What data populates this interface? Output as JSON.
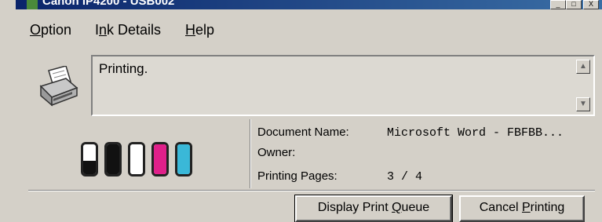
{
  "window": {
    "title": "Canon iP4200 - USB002",
    "minimize_glyph": "_",
    "maximize_glyph": "□",
    "close_glyph": "X"
  },
  "menu": {
    "option": {
      "prefix": "",
      "accel": "O",
      "rest": "ption"
    },
    "ink_details": {
      "prefix": "I",
      "accel": "n",
      "rest": "k Details"
    },
    "help": {
      "prefix": "",
      "accel": "H",
      "rest": "elp"
    }
  },
  "status": {
    "message": "Printing.",
    "scroll_up_glyph": "▲",
    "scroll_down_glyph": "▼"
  },
  "ink_tanks": [
    {
      "color": "#111111",
      "level": 0.45
    },
    {
      "color": "#111111",
      "level": 1.0
    },
    {
      "color": "#ffffff",
      "level": 1.0
    },
    {
      "color": "#e0208a",
      "level": 1.0
    },
    {
      "color": "#3ab8d8",
      "level": 1.0
    }
  ],
  "document": {
    "name_label": "Document Name:",
    "name_value": "Microsoft Word - FBFBB...",
    "owner_label": "Owner:",
    "owner_value": "",
    "pages_label": "Printing Pages:",
    "pages_value": "3 / 4"
  },
  "buttons": {
    "display_queue": {
      "before": "Display Print ",
      "accel": "Q",
      "after": "ueue"
    },
    "cancel_printing": {
      "before": "Cancel ",
      "accel": "P",
      "after": "rinting"
    }
  }
}
